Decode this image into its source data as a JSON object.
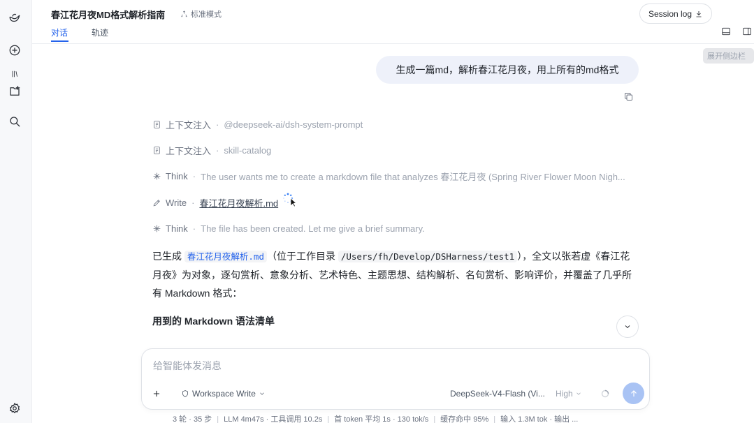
{
  "window": {
    "title": "春江花月夜MD格式解析指南",
    "mode_label": "标准模式"
  },
  "tabs": [
    {
      "label": "对话",
      "active": true
    },
    {
      "label": "轨迹",
      "active": false
    }
  ],
  "header": {
    "session_log_label": "Session log",
    "sidebar_tooltip": "展开侧边栏"
  },
  "rail": {
    "icons": [
      "logo-icon",
      "new-chat-icon",
      "library-icon",
      "new-folder-icon",
      "search-icon",
      "settings-icon"
    ]
  },
  "chat": {
    "user_message": "生成一篇md，解析春江花月夜，用上所有的md格式",
    "steps": [
      {
        "kind": "上下文注入",
        "detail": "@deepseek-ai/dsh-system-prompt",
        "icon": "document-icon"
      },
      {
        "kind": "上下文注入",
        "detail": "skill-catalog",
        "icon": "document-icon"
      },
      {
        "kind": "Think",
        "detail": "The user wants me to create a markdown file that analyzes 春江花月夜 (Spring River Flower Moon Nigh...",
        "icon": "sparkle-icon"
      },
      {
        "kind": "Write",
        "detail": "春江花月夜解析.md",
        "icon": "pen-icon"
      },
      {
        "kind": "Think",
        "detail": "The file has been created. Let me give a brief summary.",
        "icon": "sparkle-icon"
      }
    ],
    "answer": {
      "prefix": "已生成",
      "file_code": "春江花月夜解析.md",
      "mid": "（位于工作目录",
      "path_code": "/Users/fh/Develop/DSHarness/test1",
      "suffix": "），全文以张若虚《春江花月夜》为对象，逐句赏析、意象分析、艺术特色、主题思想、结构解析、名句赏析、影响评价，并覆盖了几乎所有 Markdown 格式："
    },
    "section_heading": "用到的 Markdown 语法清单"
  },
  "composer": {
    "placeholder": "给智能体发消息",
    "workspace_mode": "Workspace Write",
    "model": "DeepSeek-V4-Flash (Vi...",
    "effort": "High"
  },
  "status_bar": {
    "items": [
      "3 轮 · 35 步",
      "LLM 4m47s · 工具调用 10.2s",
      "首 token 平均 1s · 130 tok/s",
      "缓存命中 95%",
      "输入 1.3M tok · 输出 ..."
    ]
  }
}
